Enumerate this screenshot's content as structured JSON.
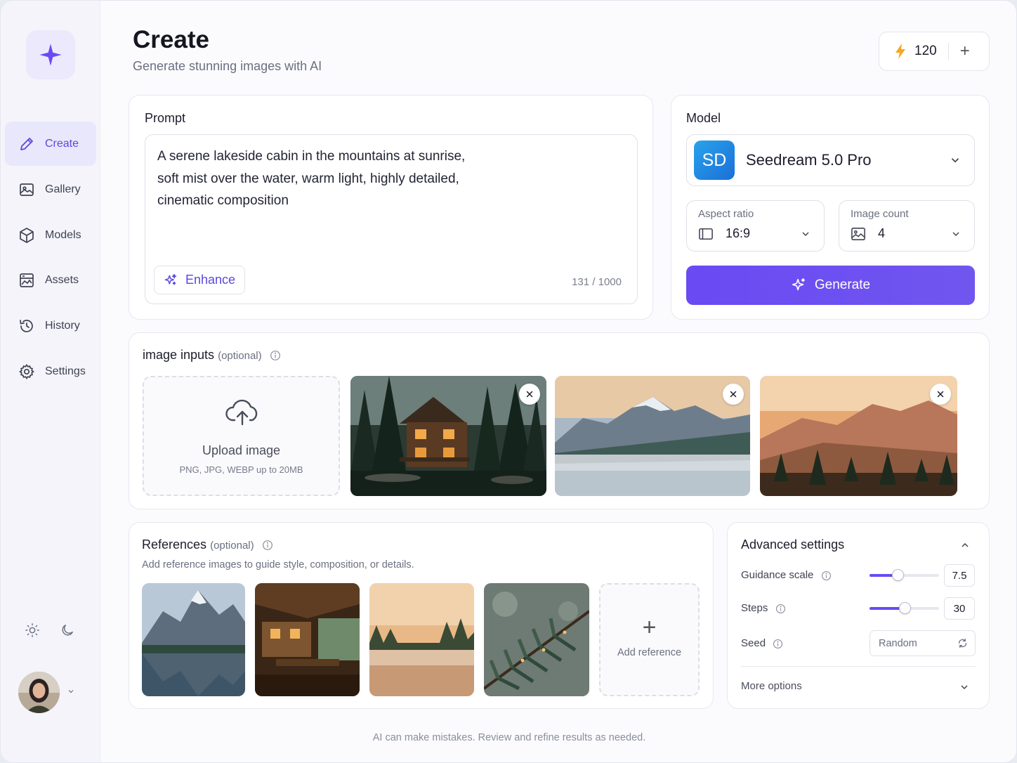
{
  "sidebar": {
    "items": [
      {
        "label": "Create",
        "icon": "pencil-icon",
        "active": true
      },
      {
        "label": "Gallery",
        "icon": "image-icon"
      },
      {
        "label": "Models",
        "icon": "cube-icon"
      },
      {
        "label": "Assets",
        "icon": "assets-icon"
      },
      {
        "label": "History",
        "icon": "history-icon"
      },
      {
        "label": "Settings",
        "icon": "gear-icon"
      }
    ]
  },
  "header": {
    "title": "Create",
    "subtitle": "Generate stunning images with AI",
    "credits": "120"
  },
  "prompt": {
    "label": "Prompt",
    "lines": [
      "A serene lakeside cabin in the mountains at sunrise,",
      "soft mist over the water, warm light, highly detailed,",
      "cinematic composition"
    ],
    "enhance_label": "Enhance",
    "counter": "131 / 1000"
  },
  "model": {
    "label": "Model",
    "badge": "SD",
    "name": "Seedream 5.0 Pro",
    "aspect_ratio_label": "Aspect ratio",
    "aspect_ratio_value": "16:9",
    "image_count_label": "Image count",
    "image_count_value": "4",
    "generate_label": "Generate"
  },
  "image_inputs": {
    "title": "image inputs",
    "optional": "(optional)",
    "upload_title": "Upload image",
    "upload_hint": "PNG, JPG, WEBP up to 20MB"
  },
  "references": {
    "title": "References",
    "optional": "(optional)",
    "subtitle": "Add reference images to guide style, composition, or details.",
    "add_label": "Add reference"
  },
  "advanced": {
    "title": "Advanced settings",
    "guidance_label": "Guidance scale",
    "guidance_value": "7.5",
    "guidance_fraction": 0.4,
    "steps_label": "Steps",
    "steps_value": "30",
    "steps_fraction": 0.5,
    "seed_label": "Seed",
    "seed_value": "Random",
    "more_label": "More options"
  },
  "footer": "AI can make mistakes. Review and refine results as needed.",
  "colors": {
    "accent": "#6a4af3",
    "credit_bolt": "#f5a623"
  }
}
